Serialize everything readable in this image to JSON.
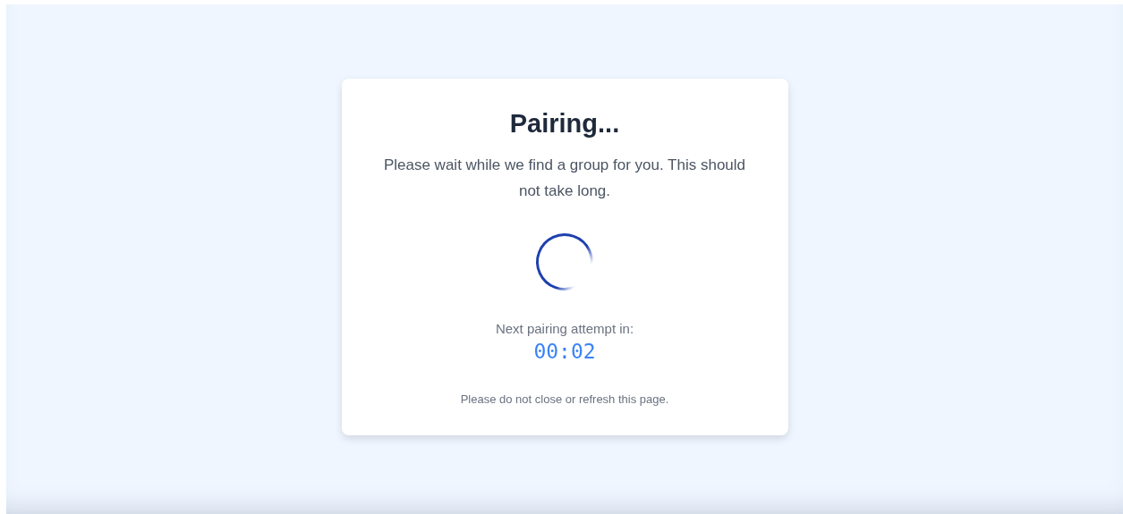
{
  "card": {
    "title": "Pairing...",
    "message": "Please wait while we find a group for you. This should not take long.",
    "countdown_label": "Next pairing attempt in:",
    "countdown": "00:02",
    "notice": "Please do not close or refresh this page."
  }
}
